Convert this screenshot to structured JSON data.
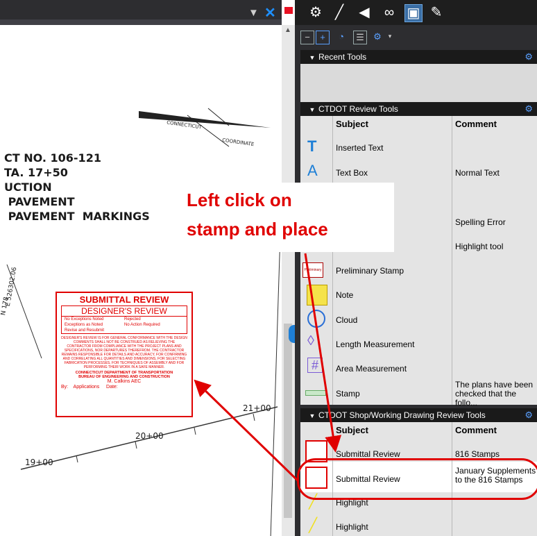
{
  "drawing": {
    "title_lines": [
      "CT NO. 106-121",
      "TA. 17+50",
      "UCTION",
      " PAVEMENT",
      " PAVEMENT  MARKINGS"
    ],
    "labels": [
      "CONNECTICUT",
      "COORDINATE",
      "21+00",
      "20+00",
      "19+00",
      "N 178",
      "E 526302.06"
    ]
  },
  "stamp": {
    "title": "SUBMITTAL REVIEW",
    "subtitle": "DESIGNER'S REVIEW",
    "opt1": "No Exceptions Noted",
    "opt2": "Rejected",
    "opt3": "Exceptions as Noted",
    "opt4": "No Action Required",
    "opt5": "Revise and Resubmit",
    "body": "DESIGNER'S REVIEW IS FOR GENERAL CONFORMANCE WITH THE DESIGN COMMENTS SHALL NOT BE CONSTRUED AS RELIEVING THE CONTRACTOR FROM COMPLIANCE WITH THE PROJECT PLANS AND SPECIFICATIONS, NOR DEPARTURES THEREFROM. THE CONTRACTOR REMAINS RESPONSIBLE FOR DETAILS AND ACCURACY, FOR CONFIRMING AND CORRELATING ALL QUANTITIES AND DIMENSIONS, FOR SELECTING FABRICATION PROCESSES, FOR TECHNIQUES OF ASSEMBLY AND FOR PERFORMING THEIR WORK IN A SAFE MANNER.",
    "dept1": "CONNECTICUT DEPARTMENT OF TRANSPORTATION",
    "dept2": "BUREAU OF ENGINEERING AND CONSTRUCTION",
    "name": "M. Calkins AEC",
    "by": "By:",
    "apps": "Applications",
    "date": "Date:"
  },
  "annotation": {
    "line1": "Left click on",
    "line2": "stamp and place"
  },
  "sections": {
    "recent": "Recent Tools",
    "ctdot": "CTDOT Review Tools",
    "shop": "CTDOT Shop/Working Drawing Review Tools"
  },
  "columns": {
    "subject": "Subject",
    "comment": "Comment"
  },
  "ctdot_tools": [
    {
      "subject": "Inserted Text",
      "comment": ""
    },
    {
      "subject": "Text Box",
      "comment": "Normal Text"
    },
    {
      "subject": "",
      "comment": ""
    },
    {
      "subject": "",
      "comment": "Spelling Error"
    },
    {
      "subject": "",
      "comment": "Highlight tool"
    },
    {
      "subject": "Preliminary Stamp",
      "comment": ""
    },
    {
      "subject": "Note",
      "comment": ""
    },
    {
      "subject": "Cloud",
      "comment": ""
    },
    {
      "subject": "Length Measurement",
      "comment": ""
    },
    {
      "subject": "Area Measurement",
      "comment": ""
    },
    {
      "subject": "Stamp",
      "comment": "The plans have been checked that the follo..."
    }
  ],
  "shop_tools": [
    {
      "subject": "Submittal Review",
      "comment": "816 Stamps"
    },
    {
      "subject": "Submittal Review",
      "comment": "January Supplements to the 816 Stamps"
    },
    {
      "subject": "Highlight",
      "comment": ""
    },
    {
      "subject": "Highlight",
      "comment": ""
    }
  ],
  "icons": {
    "prelim_label": "Preliminary"
  }
}
